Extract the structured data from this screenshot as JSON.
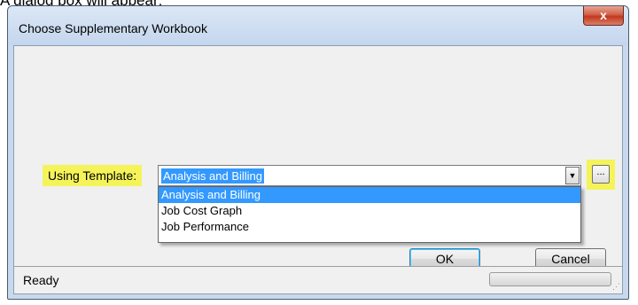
{
  "caption": "A dialog box will appear:",
  "dialog": {
    "title": "Choose Supplementary Workbook",
    "close_label": "x",
    "template_label": "Using Template:",
    "combo_value": "Analysis and Billing",
    "combo_arrow": "▼",
    "browse_label": "...",
    "options": [
      "Analysis and Billing",
      "Job Cost Graph",
      "Job Performance"
    ],
    "selected_option": "Analysis and Billing",
    "ok_label": "OK",
    "cancel_label": "Cancel",
    "status": "Ready",
    "highlight_color": "#f4f45a",
    "selection_color": "#3399ff"
  }
}
